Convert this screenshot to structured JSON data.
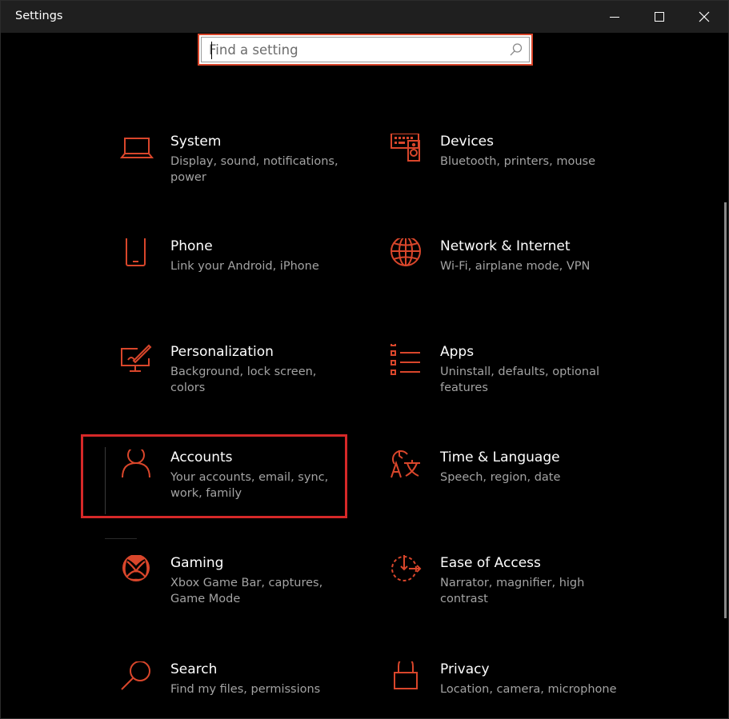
{
  "window": {
    "title": "Settings"
  },
  "search": {
    "placeholder": "Find a setting",
    "value": ""
  },
  "colors": {
    "accent": "#D9462B",
    "highlight": "#D62828",
    "background": "#000000",
    "titlebar": "#1F1F1F",
    "description": "#A3A3A3"
  },
  "categories": [
    {
      "name": "System",
      "description": "Display, sound, notifications, power",
      "icon": "laptop-icon"
    },
    {
      "name": "Devices",
      "description": "Bluetooth, printers, mouse",
      "icon": "keyboard-speaker-icon"
    },
    {
      "name": "Phone",
      "description": "Link your Android, iPhone",
      "icon": "phone-icon"
    },
    {
      "name": "Network & Internet",
      "description": "Wi-Fi, airplane mode, VPN",
      "icon": "globe-icon"
    },
    {
      "name": "Personalization",
      "description": "Background, lock screen, colors",
      "icon": "paint-monitor-icon"
    },
    {
      "name": "Apps",
      "description": "Uninstall, defaults, optional features",
      "icon": "app-list-icon"
    },
    {
      "name": "Accounts",
      "description": "Your accounts, email, sync, work, family",
      "icon": "person-icon"
    },
    {
      "name": "Time & Language",
      "description": "Speech, region, date",
      "icon": "clock-language-icon"
    },
    {
      "name": "Gaming",
      "description": "Xbox Game Bar, captures, Game Mode",
      "icon": "xbox-icon"
    },
    {
      "name": "Ease of Access",
      "description": "Narrator, magnifier, high contrast",
      "icon": "ease-of-access-icon"
    },
    {
      "name": "Search",
      "description": "Find my files, permissions",
      "icon": "magnifier-icon"
    },
    {
      "name": "Privacy",
      "description": "Location, camera, microphone",
      "icon": "padlock-icon"
    }
  ]
}
